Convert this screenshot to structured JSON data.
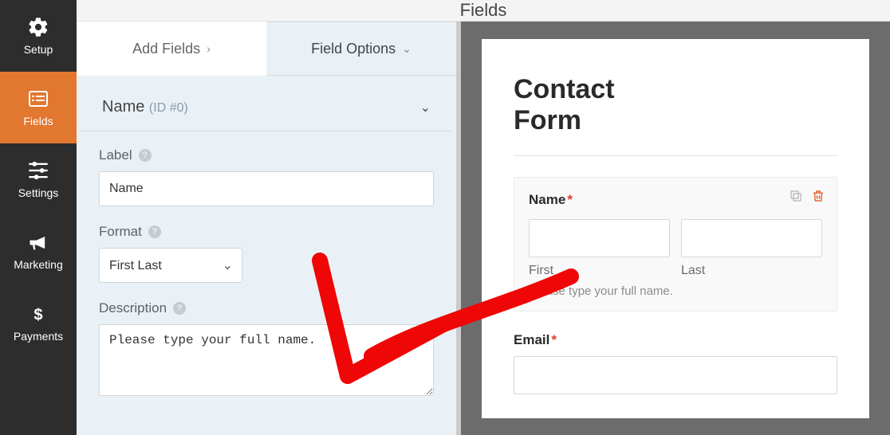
{
  "topbar": {
    "title": "Fields"
  },
  "sidebar": {
    "items": [
      {
        "label": "Setup"
      },
      {
        "label": "Fields"
      },
      {
        "label": "Settings"
      },
      {
        "label": "Marketing"
      },
      {
        "label": "Payments"
      }
    ]
  },
  "tabs": {
    "add_fields": "Add Fields",
    "field_options": "Field Options"
  },
  "section": {
    "title": "Name",
    "id": "(ID #0)"
  },
  "editor": {
    "label_label": "Label",
    "label_value": "Name",
    "format_label": "Format",
    "format_value": "First Last",
    "description_label": "Description",
    "description_value": "Please type your full name."
  },
  "preview": {
    "form_title_line1": "Contact",
    "form_title_line2": "Form",
    "name_label": "Name",
    "first_label": "First",
    "last_label": "Last",
    "description": "Please type your full name.",
    "email_label": "Email",
    "required_mark": "*"
  },
  "colors": {
    "accent": "#e27730",
    "sidebar_bg": "#2d2d2d",
    "panel_bg": "#e9f1f6",
    "danger": "#e23b2e"
  }
}
